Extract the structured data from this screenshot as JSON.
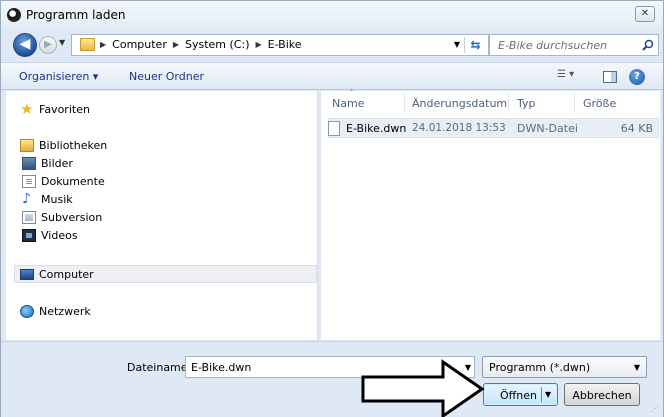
{
  "window": {
    "title": "Programm laden",
    "close_label": "✕"
  },
  "address_bar": {
    "crumbs": [
      "Computer",
      "System (C:)",
      "E-Bike"
    ],
    "search_placeholder": "E-Bike durchsuchen"
  },
  "toolbar": {
    "organize_label": "Organisieren ▾",
    "new_folder_label": "Neuer Ordner"
  },
  "nav_pane": {
    "favorites": "Favoriten",
    "libraries": "Bibliotheken",
    "library_items": [
      "Bilder",
      "Dokumente",
      "Musik",
      "Subversion",
      "Videos"
    ],
    "computer": "Computer",
    "network": "Netzwerk"
  },
  "file_list": {
    "columns": [
      "Name",
      "Änderungsdatum",
      "Typ",
      "Größe"
    ],
    "rows": [
      {
        "name": "E-Bike.dwn",
        "date": "24.01.2018 13:53",
        "type": "DWN-Datei",
        "size": "64 KB"
      }
    ]
  },
  "footer": {
    "filename_label": "Dateiname:",
    "filename_value": "E-Bike.dwn",
    "filter_value": "Programm (*.dwn)",
    "open_label": "Öffnen",
    "cancel_label": "Abbrechen"
  }
}
